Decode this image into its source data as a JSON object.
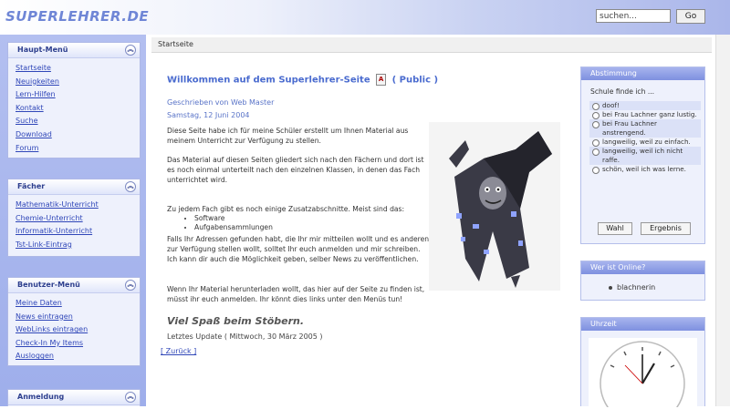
{
  "header": {
    "logo": "SUPERLEHRER.DE",
    "search_value": "suchen...",
    "go_label": "Go"
  },
  "left": {
    "haupt": {
      "title": "Haupt-Menü",
      "items": [
        "Startseite",
        "Neuigkeiten",
        "Lern-Hilfen",
        "Kontakt",
        "Suche",
        "Download",
        "Forum"
      ]
    },
    "faecher": {
      "title": "Fächer",
      "items": [
        "Mathematik-Unterricht",
        "Chemie-Unterricht",
        "Informatik-Unterricht",
        "Tst-Link-Eintrag"
      ]
    },
    "benutzer": {
      "title": "Benutzer-Menü",
      "items": [
        "Meine Daten",
        "News eintragen",
        "WebLinks eintragen",
        "Check-In My Items",
        "Ausloggen"
      ]
    },
    "anmeldung": {
      "title": "Anmeldung"
    }
  },
  "breadcrumb": "Startseite",
  "article": {
    "title": "Willkommen auf dem Superlehrer-Seite",
    "title_suffix": "( Public )",
    "author": "Geschrieben von Web Master",
    "date": "Samstag, 12 Juni 2004",
    "p1": "Diese Seite habe ich für meine Schüler erstellt um Ihnen Material aus meinem Unterricht zur Verfügung zu stellen.",
    "p2": "Das Material auf diesen Seiten gliedert sich nach den Fächern und dort ist es noch einmal unterteilt nach den einzelnen Klassen, in denen das Fach unterrichtet wird.",
    "p3": "Zu jedem Fach gibt es noch einige Zusatzabschnitte. Meist sind das:",
    "bullets": [
      "Software",
      "Aufgabensammlungen"
    ],
    "p4": "Falls Ihr Adressen gefunden habt, die Ihr mir mitteilen wollt und es anderen zur Verfügung stellen wollt, solltet Ihr euch anmelden und mir schreiben. Ich kann dir auch die Möglichkeit geben, selber News zu veröffentlichen.",
    "p5": "Wenn Ihr Material herunterladen wollt, das hier auf der Seite zu finden ist, müsst ihr euch anmelden. Ihr könnt dies links unter den Menüs tun!",
    "slogan": "Viel Spaß beim Stöbern.",
    "last_update": "Letztes Update ( Mittwoch, 30 März 2005 )",
    "back": "[ Zurück ]"
  },
  "poll": {
    "title": "Abstimmung",
    "question": "Schule finde ich ...",
    "options": [
      "doof!",
      "bei Frau Lachner ganz lustig.",
      "bei Frau Lachner anstrengend.",
      "langweilig, weil zu einfach.",
      "langweilig, weil ich nicht raffe.",
      "schön, weil ich was lerne."
    ],
    "vote": "Wahl",
    "results": "Ergebnis"
  },
  "online": {
    "title": "Wer ist Online?",
    "user": "blachnerin"
  },
  "clock": {
    "title": "Uhrzeit"
  },
  "colors": {
    "accent": "#7e90e0",
    "link": "#2f46b8",
    "title": "#4a6bcf"
  }
}
